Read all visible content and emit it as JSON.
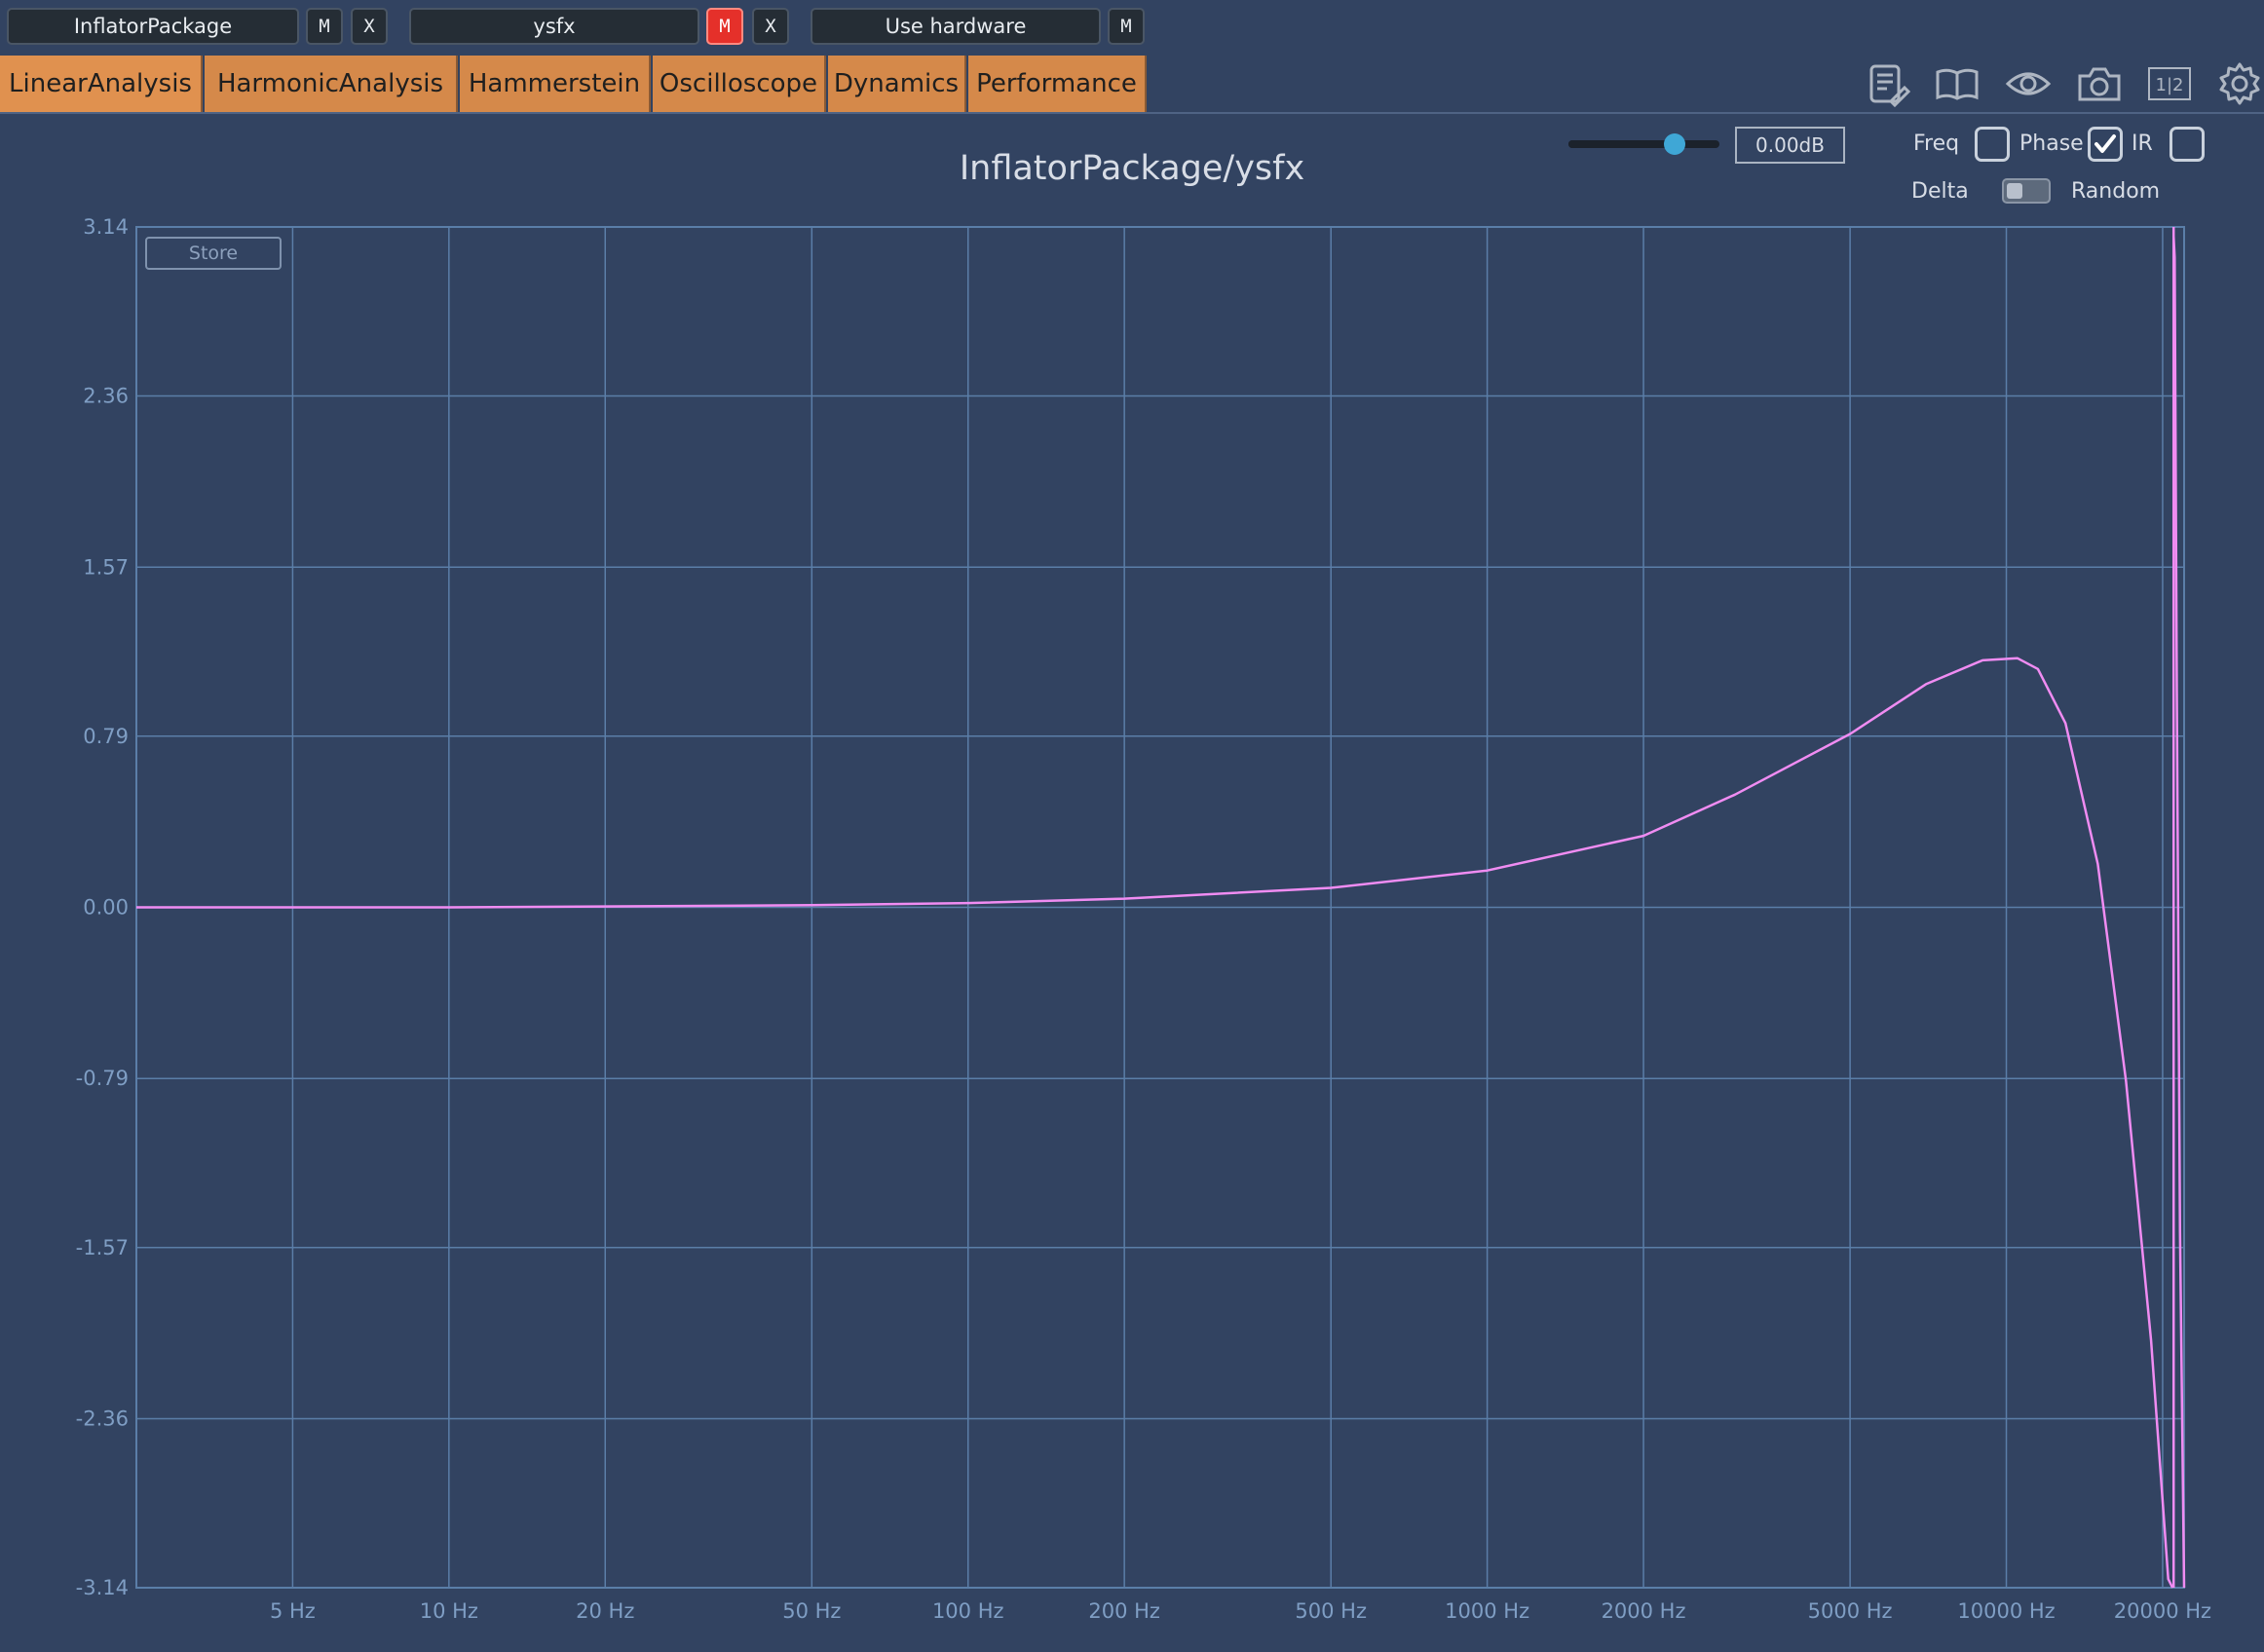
{
  "toolbar": {
    "slot1": {
      "name": "InflatorPackage",
      "mute_label": "M",
      "remove_label": "X"
    },
    "slot2": {
      "name": "ysfx",
      "mute_label": "M",
      "remove_label": "X",
      "mute_active": true
    },
    "slot3": {
      "name": "Use hardware",
      "mute_label": "M"
    }
  },
  "tabs": [
    {
      "label": "LinearAnalysis",
      "active": true
    },
    {
      "label": "HarmonicAnalysis"
    },
    {
      "label": "Hammerstein"
    },
    {
      "label": "Oscilloscope"
    },
    {
      "label": "Dynamics"
    },
    {
      "label": "Performance"
    }
  ],
  "icons": [
    "notes-icon",
    "book-icon",
    "eye-icon",
    "camera-icon",
    "split-view-icon",
    "gear-icon"
  ],
  "split_label": "1|2",
  "controls": {
    "gain_value": "0.00dB",
    "gain_slider_fraction": 0.7,
    "freq_label": "Freq",
    "phase_label": "Phase",
    "ir_label": "IR",
    "delta_label": "Delta",
    "random_label": "Random",
    "freq_checked": false,
    "phase_checked": true,
    "ir_checked": false
  },
  "colors": {
    "background": "#324361",
    "grid": "#5b7ea8",
    "trace": "#f08cf2",
    "tab": "#d5894a",
    "accent": "#3fa7d6",
    "mute_active": "#e5302a"
  },
  "store_label": "Store",
  "chart_data": {
    "type": "line",
    "title": "InflatorPackage/ysfx",
    "x_scale": "log",
    "xlim": [
      2.5,
      22000
    ],
    "ylim": [
      -3.14,
      3.14
    ],
    "x_ticks": [
      5,
      10,
      20,
      50,
      100,
      200,
      500,
      1000,
      2000,
      5000,
      10000,
      20000
    ],
    "x_tick_labels": [
      "5 Hz",
      "10 Hz",
      "20 Hz",
      "50 Hz",
      "100 Hz",
      "200 Hz",
      "500 Hz",
      "1000 Hz",
      "2000 Hz",
      "5000 Hz",
      "10000 Hz",
      "20000 Hz"
    ],
    "y_ticks": [
      3.14,
      2.36,
      1.57,
      0.79,
      0.0,
      -0.79,
      -1.57,
      -2.36,
      -3.14
    ],
    "y_tick_labels": [
      "3.14",
      "2.36",
      "1.57",
      "0.79",
      "0.00",
      "-0.79",
      "-1.57",
      "-2.36",
      "-3.14"
    ],
    "grid": true,
    "series": [
      {
        "x": [
          2.5,
          10,
          50,
          100,
          200,
          500,
          1000,
          2000,
          3000,
          5000,
          7000,
          9000,
          10500,
          11500,
          13000,
          15000,
          17000,
          19000,
          20500,
          20900,
          21000,
          21100,
          21300,
          21600,
          22000
        ],
        "y": [
          0.0,
          0.0,
          0.01,
          0.02,
          0.04,
          0.09,
          0.17,
          0.33,
          0.52,
          0.8,
          1.03,
          1.14,
          1.15,
          1.1,
          0.85,
          0.2,
          -0.8,
          -2.0,
          -3.1,
          -3.14,
          3.1,
          3.0,
          1.0,
          -1.5,
          -3.14
        ]
      }
    ]
  }
}
